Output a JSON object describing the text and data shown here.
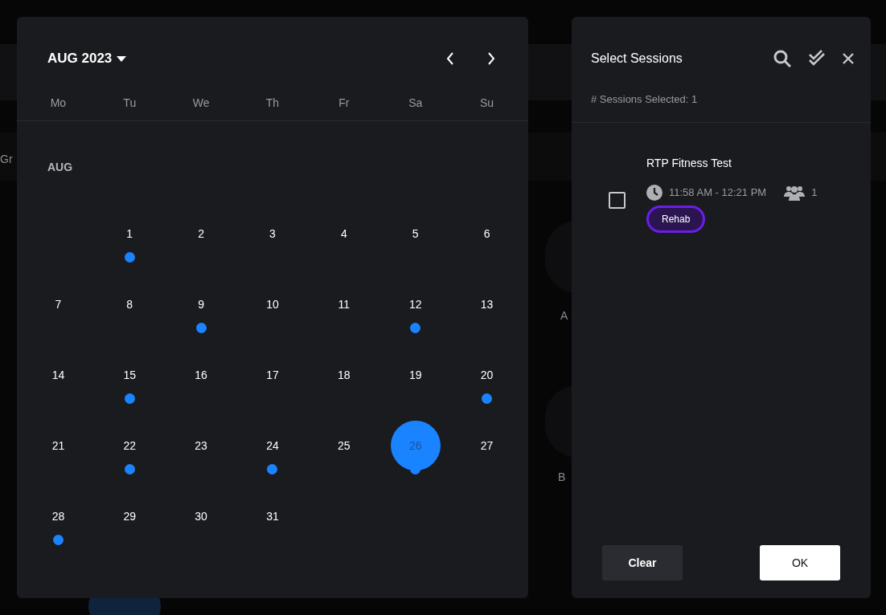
{
  "background": {
    "labels": [
      "Gr",
      "A",
      "B"
    ]
  },
  "calendar": {
    "month_title": "AUG 2023",
    "weekdays": [
      "Mo",
      "Tu",
      "We",
      "Th",
      "Fr",
      "Sa",
      "Su"
    ],
    "section_label": "AUG",
    "weeks": [
      [
        {
          "day": "1",
          "event": true,
          "selected": false
        },
        {
          "day": "2",
          "event": false,
          "selected": false
        },
        {
          "day": "3",
          "event": false,
          "selected": false
        },
        {
          "day": "4",
          "event": false,
          "selected": false
        },
        {
          "day": "5",
          "event": false,
          "selected": false
        },
        {
          "day": "6",
          "event": false,
          "selected": false
        }
      ],
      [
        {
          "day": "7",
          "event": false,
          "selected": false
        },
        {
          "day": "8",
          "event": false,
          "selected": false
        },
        {
          "day": "9",
          "event": true,
          "selected": false
        },
        {
          "day": "10",
          "event": false,
          "selected": false
        },
        {
          "day": "11",
          "event": false,
          "selected": false
        },
        {
          "day": "12",
          "event": true,
          "selected": false
        },
        {
          "day": "13",
          "event": false,
          "selected": false
        }
      ],
      [
        {
          "day": "14",
          "event": false,
          "selected": false
        },
        {
          "day": "15",
          "event": true,
          "selected": false
        },
        {
          "day": "16",
          "event": false,
          "selected": false
        },
        {
          "day": "17",
          "event": false,
          "selected": false
        },
        {
          "day": "18",
          "event": false,
          "selected": false
        },
        {
          "day": "19",
          "event": false,
          "selected": false
        },
        {
          "day": "20",
          "event": true,
          "selected": false
        }
      ],
      [
        {
          "day": "21",
          "event": false,
          "selected": false
        },
        {
          "day": "22",
          "event": true,
          "selected": false
        },
        {
          "day": "23",
          "event": false,
          "selected": false
        },
        {
          "day": "24",
          "event": true,
          "selected": false
        },
        {
          "day": "25",
          "event": false,
          "selected": false
        },
        {
          "day": "26",
          "event": true,
          "selected": true
        },
        {
          "day": "27",
          "event": false,
          "selected": false
        }
      ],
      [
        {
          "day": "28",
          "event": true,
          "selected": false
        },
        {
          "day": "29",
          "event": false,
          "selected": false
        },
        {
          "day": "30",
          "event": false,
          "selected": false
        },
        {
          "day": "31",
          "event": false,
          "selected": false
        }
      ]
    ]
  },
  "sessions_panel": {
    "title": "Select Sessions",
    "selected_count": "# Sessions Selected: 1",
    "sessions": [
      {
        "title": "RTP Fitness Test",
        "checked": false,
        "time": "11:58 AM - 12:21 PM",
        "participants": "1",
        "tag": "Rehab",
        "color": "#6a1ee8"
      }
    ],
    "buttons": {
      "clear": "Clear",
      "ok": "OK"
    }
  }
}
